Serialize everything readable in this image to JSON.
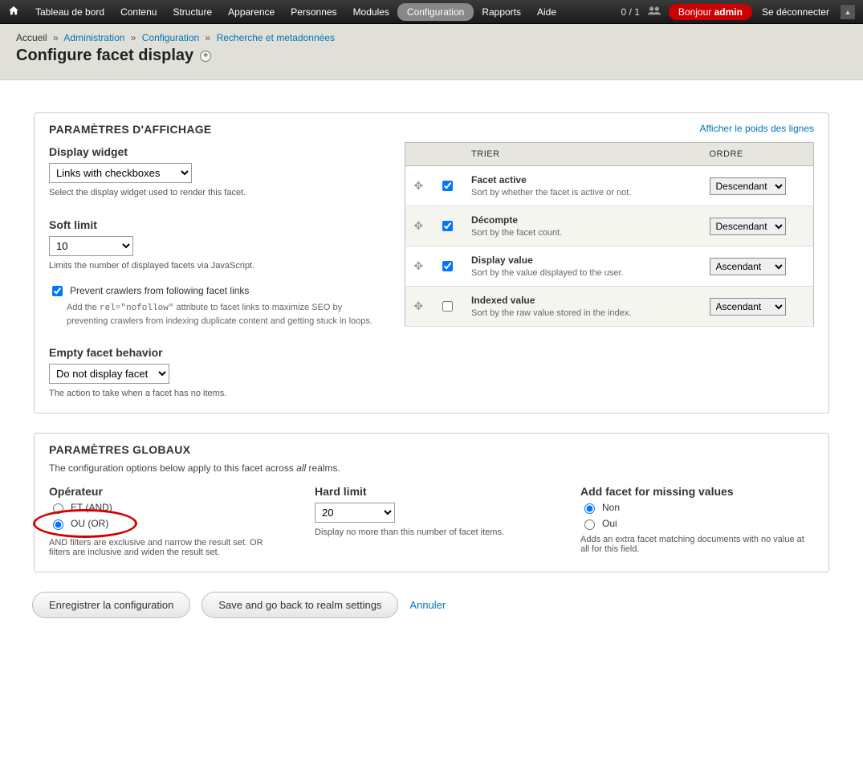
{
  "adminbar": {
    "items": [
      "Tableau de bord",
      "Contenu",
      "Structure",
      "Apparence",
      "Personnes",
      "Modules",
      "Configuration",
      "Rapports",
      "Aide"
    ],
    "active_index": 6,
    "counter": "0 / 1",
    "hello_prefix": "Bonjour ",
    "hello_user": "admin",
    "logout": "Se déconnecter"
  },
  "breadcrumb": {
    "home": "Accueil",
    "items": [
      "Administration",
      "Configuration",
      "Recherche et metadonnées"
    ]
  },
  "page_title": "Configure facet display",
  "show_weights": "Afficher le poids des lignes",
  "display_panel": {
    "legend": "PARAMÈTRES D'AFFICHAGE",
    "widget_label": "Display widget",
    "widget_options": [
      "Links with checkboxes"
    ],
    "widget_value": "Links with checkboxes",
    "widget_desc": "Select the display widget used to render this facet.",
    "soft_limit_label": "Soft limit",
    "soft_limit_options": [
      "10"
    ],
    "soft_limit_value": "10",
    "soft_limit_desc": "Limits the number of displayed facets via JavaScript.",
    "nofollow_label": "Prevent crawlers from following facet links",
    "nofollow_checked": true,
    "nofollow_desc_a": "Add the ",
    "nofollow_desc_code": "rel=\"nofollow\"",
    "nofollow_desc_b": " attribute to facet links to maximize SEO by preventing crawlers from indexing duplicate content and getting stuck in loops.",
    "empty_label": "Empty facet behavior",
    "empty_options": [
      "Do not display facet"
    ],
    "empty_value": "Do not display facet",
    "empty_desc": "The action to take when a facet has no items."
  },
  "sort_table": {
    "headers": {
      "blank1": "",
      "blank2": "",
      "sort": "TRIER",
      "order": "ORDRE"
    },
    "order_options": [
      "Descendant",
      "Ascendant"
    ],
    "rows": [
      {
        "checked": true,
        "title": "Facet active",
        "desc": "Sort by whether the facet is active or not.",
        "order": "Descendant"
      },
      {
        "checked": true,
        "title": "Décompte",
        "desc": "Sort by the facet count.",
        "order": "Descendant"
      },
      {
        "checked": true,
        "title": "Display value",
        "desc": "Sort by the value displayed to the user.",
        "order": "Ascendant"
      },
      {
        "checked": false,
        "title": "Indexed value",
        "desc": "Sort by the raw value stored in the index.",
        "order": "Ascendant"
      }
    ]
  },
  "global_panel": {
    "legend": "PARAMÈTRES GLOBAUX",
    "desc_a": "The configuration options below apply to this facet across ",
    "desc_i": "all",
    "desc_b": " realms.",
    "operator_label": "Opérateur",
    "op_and": "ET (AND)",
    "op_or": "OU (OR)",
    "op_selected": "or",
    "op_desc": "AND filters are exclusive and narrow the result set. OR filters are inclusive and widen the result set.",
    "hard_limit_label": "Hard limit",
    "hard_limit_options": [
      "20"
    ],
    "hard_limit_value": "20",
    "hard_limit_desc": "Display no more than this number of facet items.",
    "missing_label": "Add facet for missing values",
    "missing_no": "Non",
    "missing_yes": "Oui",
    "missing_selected": "no",
    "missing_desc": "Adds an extra facet matching documents with no value at all for this field."
  },
  "actions": {
    "save": "Enregistrer la configuration",
    "save_back": "Save and go back to realm settings",
    "cancel": "Annuler"
  }
}
